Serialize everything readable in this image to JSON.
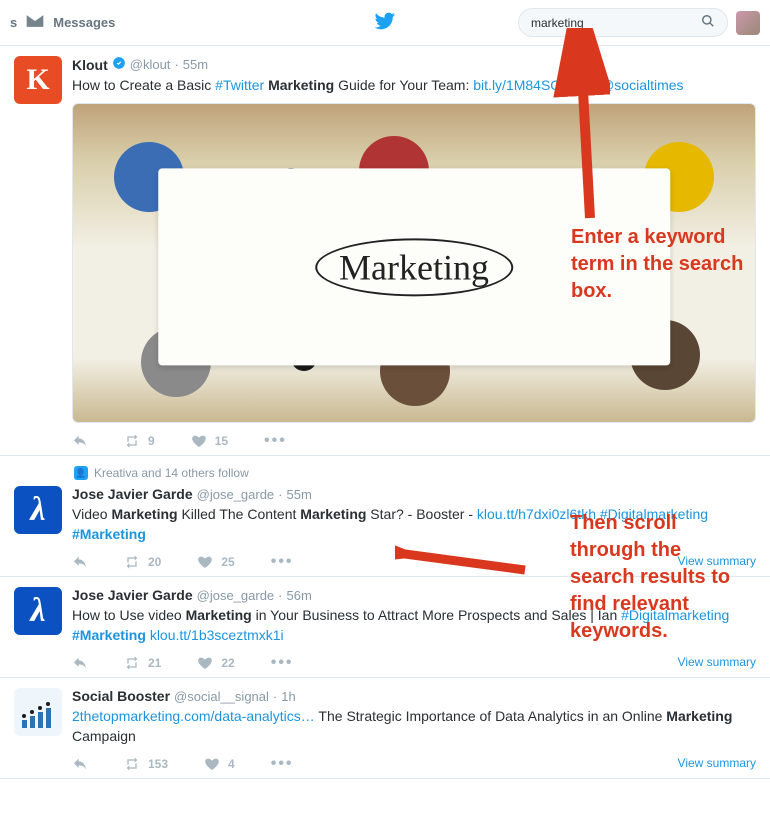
{
  "topbar": {
    "partial_tab": "s",
    "messages_label": "Messages",
    "search_value": "marketing"
  },
  "annotations": {
    "search_box": "Enter a keyword term in the search box.",
    "results": "Then scroll through the search results to find relevant keywords."
  },
  "context": {
    "followers": "Kreativa and 14 others follow"
  },
  "tweets": [
    {
      "name": "Klout",
      "verified": true,
      "handle": "@klout",
      "time": "55m",
      "text_parts": [
        {
          "t": "How to Create a Basic "
        },
        {
          "t": "#Twitter",
          "cls": "link"
        },
        {
          "t": " "
        },
        {
          "t": "Marketing",
          "cls": "bold"
        },
        {
          "t": " Guide for Your Team: "
        },
        {
          "t": "bit.ly/1M84SOW",
          "cls": "link"
        },
        {
          "t": " via "
        },
        {
          "t": "@socialtimes",
          "cls": "link"
        }
      ],
      "retweets": "9",
      "likes": "15",
      "view_summary": ""
    },
    {
      "name": "Jose Javier Garde",
      "verified": false,
      "handle": "@jose_garde",
      "time": "55m",
      "text_parts": [
        {
          "t": "Video "
        },
        {
          "t": "Marketing",
          "cls": "bold"
        },
        {
          "t": " Killed The Content "
        },
        {
          "t": "Marketing",
          "cls": "bold"
        },
        {
          "t": " Star? - Booster - "
        },
        {
          "t": "klou.tt/h7dxi0zl6tkh",
          "cls": "link"
        },
        {
          "t": "  "
        },
        {
          "t": "#Digitalmarketing",
          "cls": "link"
        },
        {
          "t": " "
        },
        {
          "t": "#Marketing",
          "cls": "link bold"
        }
      ],
      "retweets": "20",
      "likes": "25",
      "view_summary": "View summary"
    },
    {
      "name": "Jose Javier Garde",
      "verified": false,
      "handle": "@jose_garde",
      "time": "56m",
      "text_parts": [
        {
          "t": "How to Use video "
        },
        {
          "t": "Marketing",
          "cls": "bold"
        },
        {
          "t": " in Your Business to Attract More Prospects and Sales | Ian  "
        },
        {
          "t": "#Digitalmarketing",
          "cls": "link"
        },
        {
          "t": " "
        },
        {
          "t": "#Marketing",
          "cls": "link bold"
        },
        {
          "t": "  "
        },
        {
          "t": "klou.tt/1b3sceztmxk1i",
          "cls": "link"
        }
      ],
      "retweets": "21",
      "likes": "22",
      "view_summary": "View summary"
    },
    {
      "name": "Social Booster",
      "verified": false,
      "handle": "@social__signal",
      "time": "1h",
      "text_parts": [
        {
          "t": "2thetopmarketing.com/data-analytics…",
          "cls": "link"
        },
        {
          "t": " The Strategic Importance of Data Analytics in an Online "
        },
        {
          "t": "Marketing",
          "cls": "bold"
        },
        {
          "t": " Campaign"
        }
      ],
      "retweets": "153",
      "likes": "4",
      "view_summary": "View summary"
    }
  ],
  "media_word": "Marketing"
}
